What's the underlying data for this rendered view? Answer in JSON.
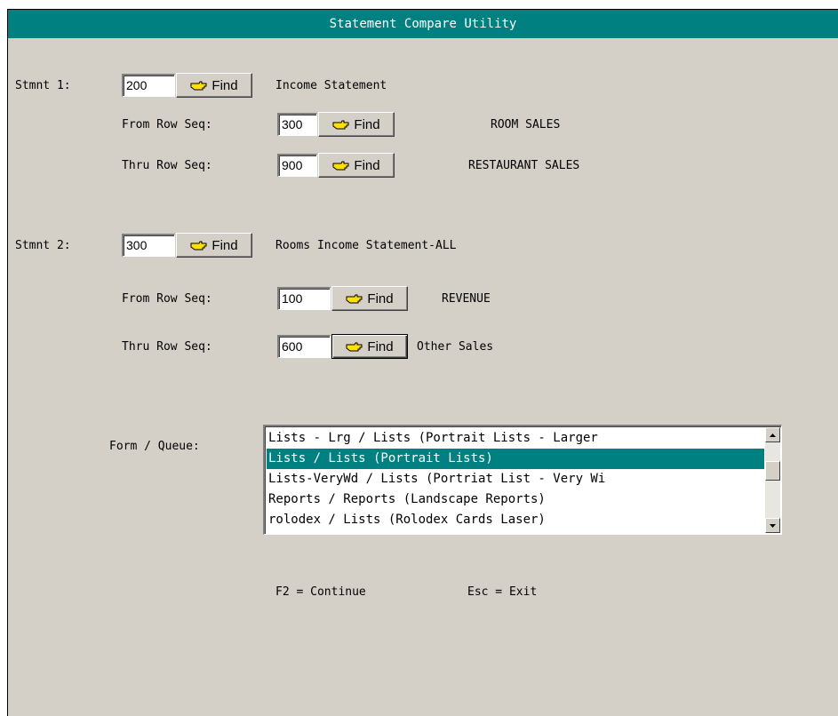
{
  "window": {
    "title": "Statement Compare Utility"
  },
  "find_label": "Find",
  "stmt1": {
    "label": "Stmnt 1:",
    "value": "200",
    "desc": "Income Statement",
    "from": {
      "label": "From Row Seq:",
      "value": "300",
      "desc": "ROOM SALES"
    },
    "thru": {
      "label": "Thru Row Seq:",
      "value": "900",
      "desc": "RESTAURANT SALES"
    }
  },
  "stmt2": {
    "label": "Stmnt 2:",
    "value": "300",
    "desc": "Rooms Income Statement-ALL",
    "from": {
      "label": "From Row Seq:",
      "value": "100",
      "desc": "REVENUE"
    },
    "thru": {
      "label": "Thru Row Seq:",
      "value": "600",
      "desc": "Other Sales"
    }
  },
  "form_queue": {
    "label": "Form / Queue:",
    "items": [
      "Lists - Lrg / Lists (Portrait Lists - Larger",
      "Lists / Lists (Portrait Lists)",
      "Lists-VeryWd / Lists (Portriat List - Very Wi",
      "Reports / Reports (Landscape Reports)",
      "rolodex / Lists (Rolodex Cards Laser)"
    ],
    "selected_index": 1
  },
  "footer": {
    "continue": "F2 = Continue",
    "exit": "Esc = Exit"
  },
  "icons": {
    "find": "pointing-hand-icon",
    "scroll_up": "arrow-up-icon",
    "scroll_down": "arrow-down-icon"
  },
  "colors": {
    "title_bg": "#008080",
    "selection_bg": "#008080",
    "window_bg": "#d4d0c8"
  }
}
